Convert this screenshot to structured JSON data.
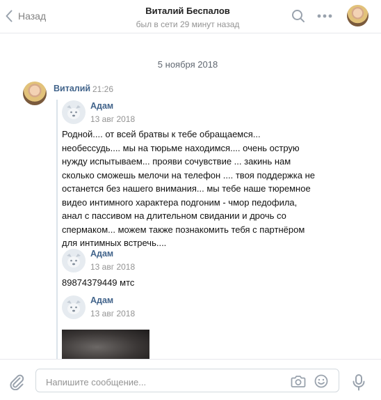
{
  "header": {
    "back_label": "Назад",
    "title": "Виталий Беспалов",
    "subtitle": "был в сети 29 минут назад",
    "icons": [
      "back-chevron-icon",
      "search-icon",
      "more-icon",
      "avatar"
    ]
  },
  "conversation": {
    "date_separator": "5 ноября 2018",
    "message": {
      "sender": "Виталий",
      "time": "21:26",
      "forwarded": [
        {
          "author": "Адам",
          "date": "13 авг 2018",
          "text_lines": [
            "Родной.... от всей братвы к тебе обращаемся...",
            "необессудь.... мы на тюрьме находимся.... очень острую",
            "нужду испытываем... прояви сочувствие ... закинь нам",
            "сколько сможешь мелочи на телефон .... твоя поддержка не",
            "останется без нашего внимания... мы тебе наше тюремное",
            "видео интимного характера подгоним - чмор педофила,",
            "анал с пассивом на длительном свидании и дрочь со",
            "спермаком... можем также познакомить тебя с партнёром",
            "для интимных встречь...."
          ]
        },
        {
          "author": "Адам",
          "date": "13 авг 2018",
          "text": "89874379449 мтс"
        },
        {
          "author": "Адам",
          "date": "13 авг 2018",
          "attachment": "photo"
        }
      ]
    }
  },
  "composer": {
    "placeholder": "Напишите сообщение...",
    "icons": [
      "attach-icon",
      "camera-icon",
      "emoji-icon",
      "microphone-icon"
    ]
  },
  "colors": {
    "link_blue": "#42648b",
    "muted_gray": "#939393",
    "icon_gray": "#99a2ad",
    "divider": "#e7e8ec"
  }
}
